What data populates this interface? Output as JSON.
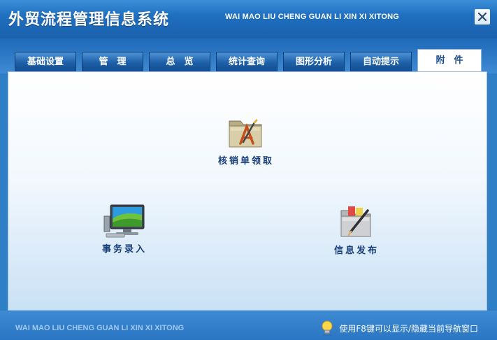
{
  "header": {
    "title": "外贸流程管理信息系统",
    "subtitle": "WAI MAO LIU CHENG GUAN LI XIN XI XITONG"
  },
  "tabs": [
    {
      "label": "基础设置",
      "active": false
    },
    {
      "label": "管　理",
      "active": false
    },
    {
      "label": "总　览",
      "active": false
    },
    {
      "label": "统计查询",
      "active": false
    },
    {
      "label": "图形分析",
      "active": false
    },
    {
      "label": "自动提示",
      "active": false
    },
    {
      "label": "附　件",
      "active": true
    }
  ],
  "items": {
    "verification": {
      "label": "核销单领取",
      "icon": "folder-app-icon"
    },
    "transaction": {
      "label": "事务录入",
      "icon": "monitor-icon"
    },
    "publish": {
      "label": "信息发布",
      "icon": "folder-pen-icon"
    }
  },
  "footer": {
    "text": "WAI MAO LIU CHENG GUAN LI XIN XI XITONG",
    "hint": "使用F8键可以显示/隐藏当前导航窗口"
  },
  "colors": {
    "header": "#1f6fc0",
    "tab": "#1d5fa8",
    "panel_bottom": "#c9e1f5",
    "label": "#1a3f78"
  }
}
